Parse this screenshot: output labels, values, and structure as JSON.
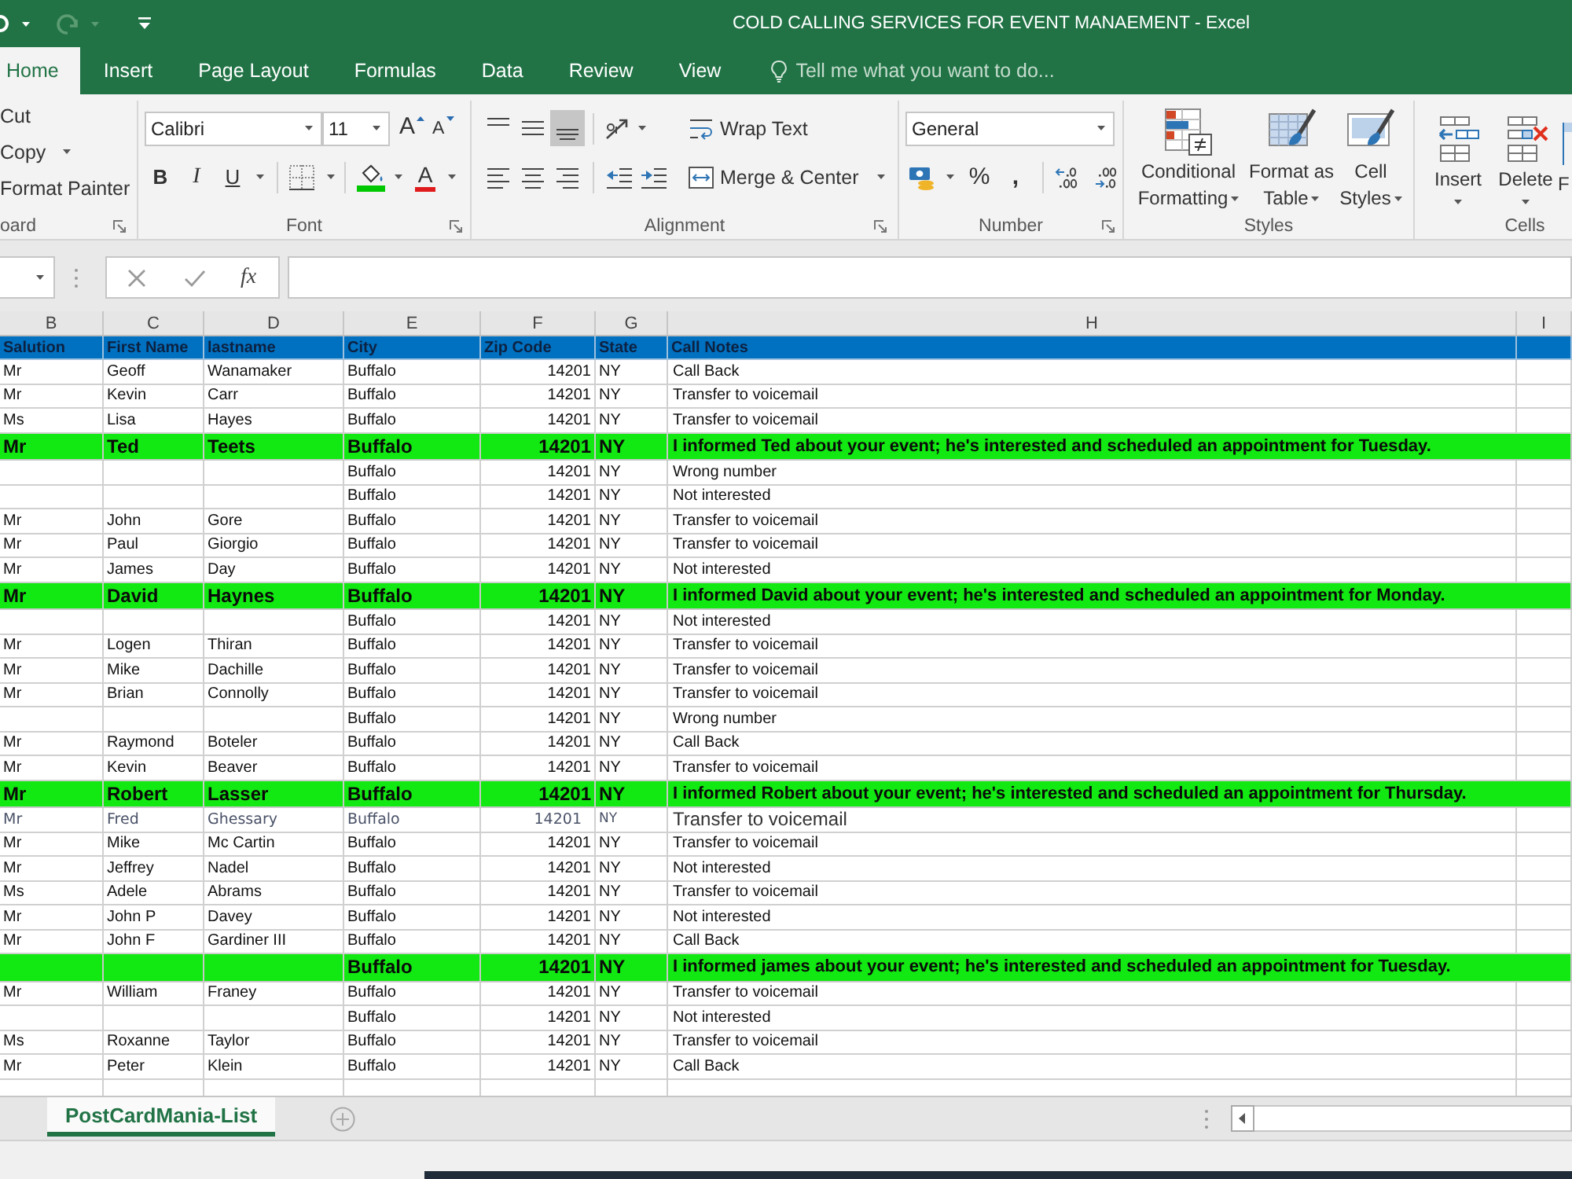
{
  "window": {
    "title": "COLD CALLING SERVICES FOR EVENT MANAEMENT - Excel"
  },
  "tabs": [
    {
      "label": "Home",
      "selected": true
    },
    {
      "label": "Insert",
      "selected": false
    },
    {
      "label": "Page Layout",
      "selected": false
    },
    {
      "label": "Formulas",
      "selected": false
    },
    {
      "label": "Data",
      "selected": false
    },
    {
      "label": "Review",
      "selected": false
    },
    {
      "label": "View",
      "selected": false
    }
  ],
  "tell_me": {
    "placeholder": "Tell me what you want to do..."
  },
  "ribbon": {
    "clipboard": {
      "items": [
        {
          "label": "Cut",
          "menu": false
        },
        {
          "label": "Copy",
          "menu": true
        },
        {
          "label": "Format Painter",
          "menu": false
        }
      ],
      "label": "oard"
    },
    "font": {
      "name": "Calibri",
      "size": "11",
      "grow_font_glyph": "A",
      "shrink_font_glyph": "A",
      "bold_glyph": "B",
      "italic_glyph": "I",
      "underline_glyph": "U",
      "font_color_glyph": "A",
      "label": "Font"
    },
    "alignment": {
      "vertical": [
        {
          "kind": "top",
          "selected": false
        },
        {
          "kind": "middle",
          "selected": false
        },
        {
          "kind": "bottom",
          "selected": true
        }
      ],
      "wrap_text": "Wrap Text",
      "merge": "Merge & Center",
      "label": "Alignment"
    },
    "number": {
      "format": "General",
      "percent_glyph": "%",
      "comma_glyph": ",",
      "label": "Number"
    },
    "styles": {
      "buttons": [
        {
          "kind": "conditional",
          "label": "Conditional Formatting"
        },
        {
          "kind": "table",
          "label": "Format as Table"
        },
        {
          "kind": "cell",
          "label": "Cell Styles"
        }
      ],
      "label": "Styles"
    },
    "cells": {
      "buttons": [
        {
          "kind": "insert",
          "label": "Insert"
        },
        {
          "kind": "delete",
          "label": "Delete"
        },
        {
          "kind": "format",
          "label": "F"
        }
      ],
      "label": "Cells"
    }
  },
  "formula_bar": {
    "function_glyph": "fx"
  },
  "sheet": {
    "column_letters": [
      "B",
      "C",
      "D",
      "E",
      "F",
      "G",
      "H",
      "I"
    ],
    "headings": [
      "Salution",
      "First Name",
      "lastname",
      "City",
      "Zip Code",
      "State",
      "Call Notes"
    ],
    "rows": [
      {
        "kind": "plain",
        "salutation": "Mr",
        "first_name": "Geoff",
        "last_name": "Wanamaker",
        "city": "Buffalo",
        "zip_code": "14201",
        "state": "NY",
        "call_notes": "Call Back"
      },
      {
        "kind": "plain",
        "salutation": "Mr",
        "first_name": "Kevin",
        "last_name": "Carr",
        "city": "Buffalo",
        "zip_code": "14201",
        "state": "NY",
        "call_notes": "Transfer to voicemail"
      },
      {
        "kind": "plain",
        "salutation": "Ms",
        "first_name": "Lisa",
        "last_name": "Hayes",
        "city": "Buffalo",
        "zip_code": "14201",
        "state": "NY",
        "call_notes": "Transfer to voicemail"
      },
      {
        "kind": "lead",
        "salutation": "Mr",
        "first_name": "Ted",
        "last_name": "Teets",
        "city": "Buffalo",
        "zip_code": "14201",
        "state": "NY",
        "call_notes": "I informed Ted about your event; he's interested and scheduled an appointment for Tuesday."
      },
      {
        "kind": "plain",
        "city": "Buffalo",
        "zip_code": "14201",
        "state": "NY",
        "call_notes": "Wrong number"
      },
      {
        "kind": "plain",
        "city": "Buffalo",
        "zip_code": "14201",
        "state": "NY",
        "call_notes": "Not interested"
      },
      {
        "kind": "plain",
        "salutation": "Mr",
        "first_name": "John",
        "last_name": "Gore",
        "city": "Buffalo",
        "zip_code": "14201",
        "state": "NY",
        "call_notes": "Transfer to voicemail"
      },
      {
        "kind": "plain",
        "salutation": "Mr",
        "first_name": "Paul",
        "last_name": "Giorgio",
        "city": "Buffalo",
        "zip_code": "14201",
        "state": "NY",
        "call_notes": "Transfer to voicemail"
      },
      {
        "kind": "plain",
        "salutation": "Mr",
        "first_name": "James",
        "last_name": "Day",
        "city": "Buffalo",
        "zip_code": "14201",
        "state": "NY",
        "call_notes": "Not interested"
      },
      {
        "kind": "lead",
        "salutation": "Mr",
        "first_name": "David",
        "last_name": "Haynes",
        "city": "Buffalo",
        "zip_code": "14201",
        "state": "NY",
        "call_notes": "I informed David about your event; he's interested and scheduled an appointment for Monday."
      },
      {
        "kind": "plain",
        "city": "Buffalo",
        "zip_code": "14201",
        "state": "NY",
        "call_notes": "Not interested"
      },
      {
        "kind": "plain",
        "salutation": "Mr",
        "first_name": "Logen",
        "last_name": "Thiran",
        "city": "Buffalo",
        "zip_code": "14201",
        "state": "NY",
        "call_notes": "Transfer to voicemail"
      },
      {
        "kind": "plain",
        "salutation": "Mr",
        "first_name": "Mike",
        "last_name": "Dachille",
        "city": "Buffalo",
        "zip_code": "14201",
        "state": "NY",
        "call_notes": "Transfer to voicemail"
      },
      {
        "kind": "plain",
        "salutation": "Mr",
        "first_name": "Brian",
        "last_name": "Connolly",
        "city": "Buffalo",
        "zip_code": "14201",
        "state": "NY",
        "call_notes": "Transfer to voicemail"
      },
      {
        "kind": "plain",
        "city": "Buffalo",
        "zip_code": "14201",
        "state": "NY",
        "call_notes": "Wrong number"
      },
      {
        "kind": "plain",
        "salutation": "Mr",
        "first_name": "Raymond",
        "last_name": "Boteler",
        "city": "Buffalo",
        "zip_code": "14201",
        "state": "NY",
        "call_notes": "Call Back"
      },
      {
        "kind": "plain",
        "salutation": "Mr",
        "first_name": "Kevin",
        "last_name": "Beaver",
        "city": "Buffalo",
        "zip_code": "14201",
        "state": "NY",
        "call_notes": "Transfer to voicemail"
      },
      {
        "kind": "lead",
        "salutation": "Mr",
        "first_name": "Robert",
        "last_name": "Lasser",
        "city": "Buffalo",
        "zip_code": "14201",
        "state": "NY",
        "call_notes": "I informed Robert about your event; he's interested and scheduled an appointment for Thursday."
      },
      {
        "kind": "alt",
        "salutation": "Mr",
        "first_name": "Fred",
        "last_name": "Ghessary",
        "city": "Buffalo",
        "zip_code": "14201",
        "state": "NY",
        "call_notes": "Transfer to voicemail"
      },
      {
        "kind": "plain",
        "salutation": "Mr",
        "first_name": "Mike",
        "last_name": "Mc Cartin",
        "city": "Buffalo",
        "zip_code": "14201",
        "state": "NY",
        "call_notes": "Transfer to voicemail"
      },
      {
        "kind": "plain",
        "salutation": "Mr",
        "first_name": "Jeffrey",
        "last_name": "Nadel",
        "city": "Buffalo",
        "zip_code": "14201",
        "state": "NY",
        "call_notes": "Not interested"
      },
      {
        "kind": "plain",
        "salutation": "Ms",
        "first_name": "Adele",
        "last_name": "Abrams",
        "city": "Buffalo",
        "zip_code": "14201",
        "state": "NY",
        "call_notes": "Transfer to voicemail"
      },
      {
        "kind": "plain",
        "salutation": "Mr",
        "first_name": "John P",
        "last_name": "Davey",
        "city": "Buffalo",
        "zip_code": "14201",
        "state": "NY",
        "call_notes": "Not interested"
      },
      {
        "kind": "plain",
        "salutation": "Mr",
        "first_name": "John F",
        "last_name": "Gardiner III",
        "city": "Buffalo",
        "zip_code": "14201",
        "state": "NY",
        "call_notes": "Call Back"
      },
      {
        "kind": "lead",
        "city": "Buffalo",
        "zip_code": "14201",
        "state": "NY",
        "call_notes": "I informed james about your event; he's interested and scheduled an appointment for Tuesday."
      },
      {
        "kind": "plain",
        "salutation": "Mr",
        "first_name": "William",
        "last_name": "Franey",
        "city": "Buffalo",
        "zip_code": "14201",
        "state": "NY",
        "call_notes": "Transfer to voicemail"
      },
      {
        "kind": "plain",
        "city": "Buffalo",
        "zip_code": "14201",
        "state": "NY",
        "call_notes": "Not interested"
      },
      {
        "kind": "plain",
        "salutation": "Ms",
        "first_name": "Roxanne",
        "last_name": "Taylor",
        "city": "Buffalo",
        "zip_code": "14201",
        "state": "NY",
        "call_notes": "Transfer to voicemail"
      },
      {
        "kind": "plain",
        "salutation": "Mr",
        "first_name": "Peter",
        "last_name": "Klein",
        "city": "Buffalo",
        "zip_code": "14201",
        "state": "NY",
        "call_notes": "Call Back"
      }
    ]
  },
  "sheet_tabs": [
    {
      "label": "PostCardMania-List",
      "selected": true
    }
  ]
}
